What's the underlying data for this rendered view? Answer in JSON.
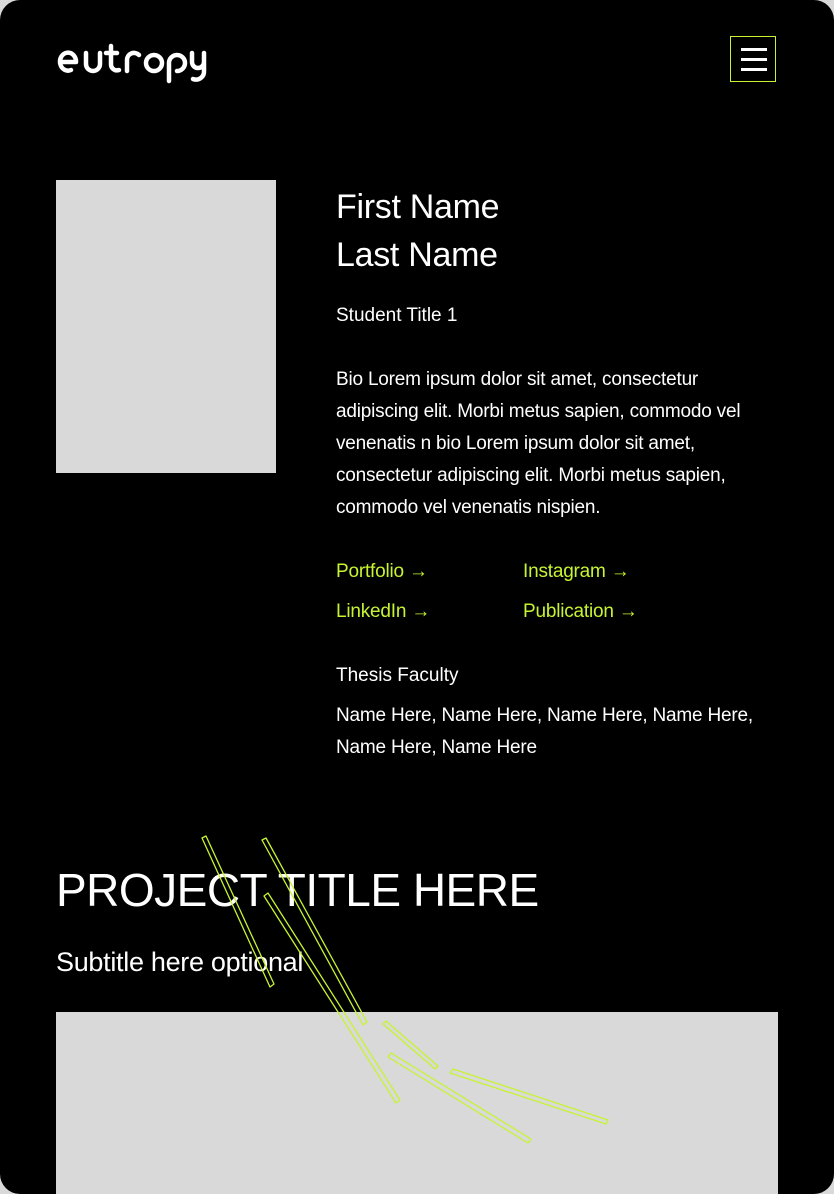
{
  "brand": {
    "logo_text": "entropy",
    "accent_color": "#c6f432"
  },
  "header": {
    "menu_icon": "hamburger-menu-icon"
  },
  "profile": {
    "first_name": "First Name",
    "last_name": "Last Name",
    "student_title": "Student Title 1",
    "bio": "Bio Lorem ipsum dolor sit amet, consectetur adipiscing elit. Morbi metus sapien, commodo vel venenatis n bio Lorem ipsum dolor sit amet, consectetur adipiscing elit. Morbi metus sapien, commodo vel venenatis nispien."
  },
  "links": {
    "portfolio": "Portfolio →",
    "instagram": "Instagram →",
    "linkedin": "LinkedIn →",
    "publication": "Publication →"
  },
  "faculty": {
    "heading": "Thesis Faculty",
    "names": "Name Here, Name Here, Name Here, Name Here, Name Here, Name Here"
  },
  "project": {
    "title": "PROJECT TITLE HERE",
    "subtitle": "Subtitle here optional"
  }
}
